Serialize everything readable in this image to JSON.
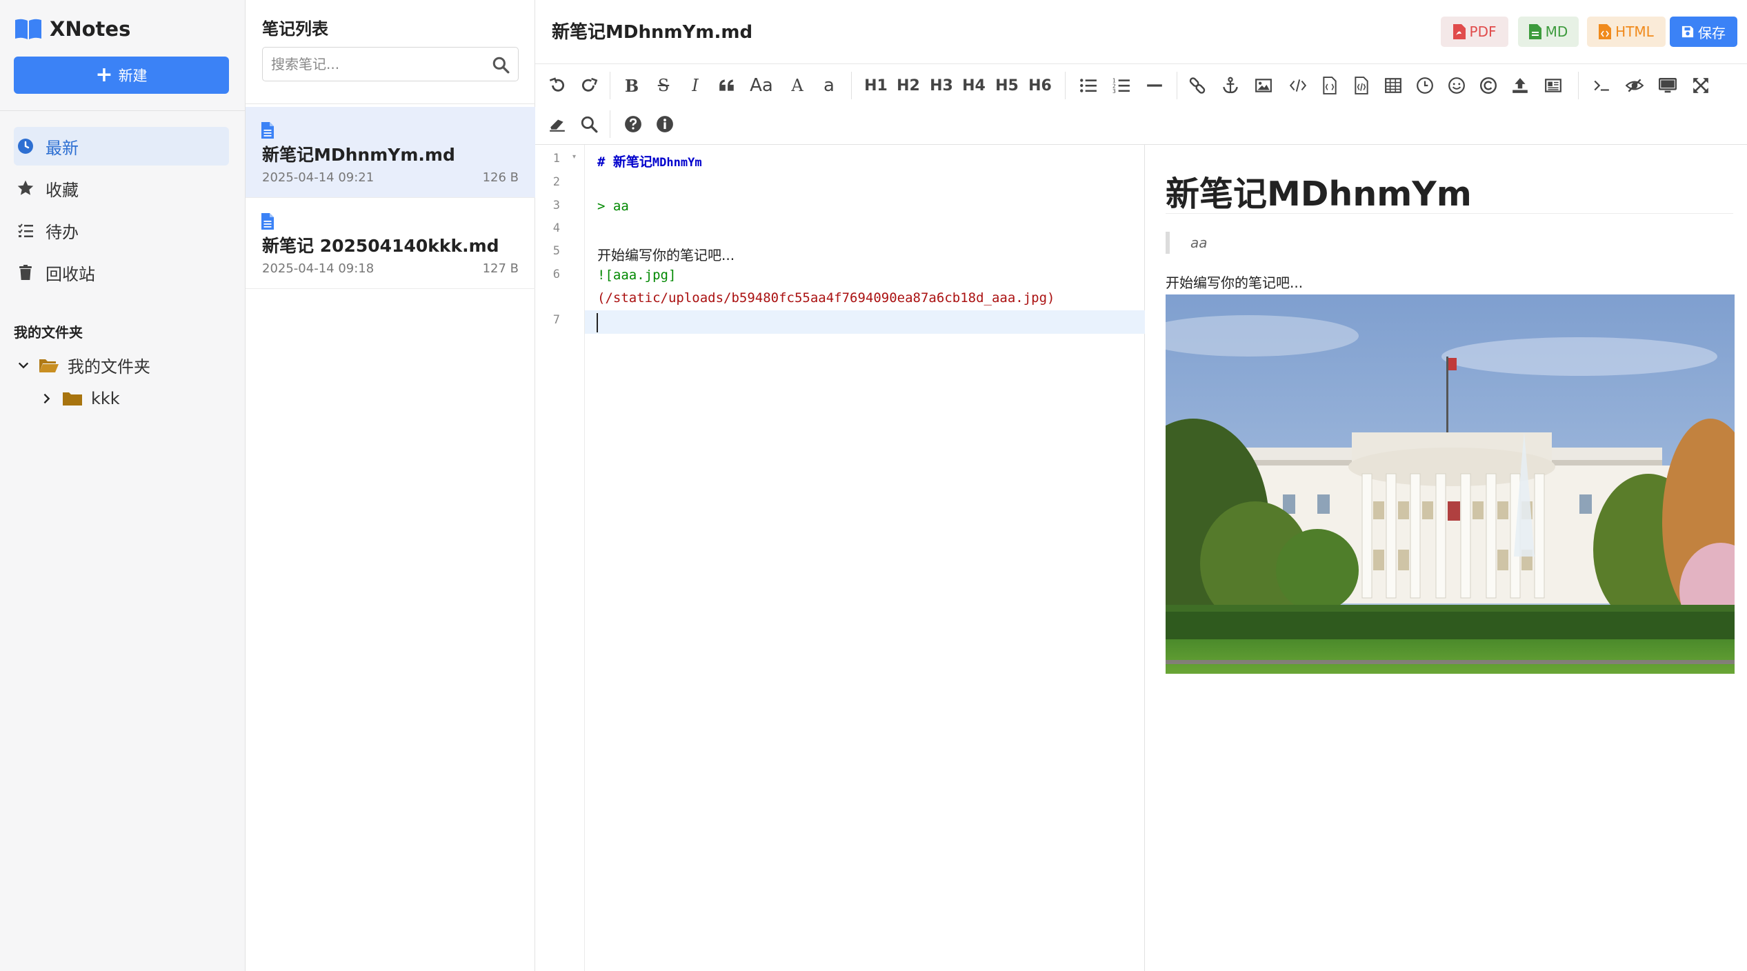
{
  "app": {
    "name": "XNotes"
  },
  "sidebar": {
    "new_button": "新建",
    "nav": [
      {
        "label": "最新",
        "icon": "clock-icon",
        "active": true
      },
      {
        "label": "收藏",
        "icon": "star-icon"
      },
      {
        "label": "待办",
        "icon": "todo-list-icon"
      },
      {
        "label": "回收站",
        "icon": "trash-icon"
      }
    ],
    "folders_title": "我的文件夹",
    "folders": [
      {
        "label": "我的文件夹",
        "expanded": true,
        "children": [
          {
            "label": "kkk",
            "expanded": false
          }
        ]
      }
    ]
  },
  "notelist": {
    "title": "笔记列表",
    "search_placeholder": "搜索笔记...",
    "notes": [
      {
        "title": "新笔记MDhnmYm.md",
        "date": "2025-04-14 09:21",
        "size": "126 B",
        "active": true
      },
      {
        "title": "新笔记 202504140kkk.md",
        "date": "2025-04-14 09:18",
        "size": "127 B"
      }
    ]
  },
  "editor": {
    "title": "新笔记MDhnmYm.md",
    "buttons": {
      "pdf": "PDF",
      "md": "MD",
      "html": "HTML",
      "save": "保存"
    },
    "toolbar": {
      "headings": [
        "H1",
        "H2",
        "H3",
        "H4",
        "H5",
        "H6"
      ],
      "font_size_label": "Aa"
    },
    "code": {
      "line_numbers": [
        "1",
        "2",
        "3",
        "4",
        "5",
        "6",
        "7"
      ],
      "line1_hash": "# ",
      "line1_title": "新笔记",
      "line1_title_rest": "MDhnmYm",
      "line3": "> aa",
      "line5": "开始编写你的笔记吧...",
      "line6_alt": "![aaa.jpg]",
      "line6_url": "(/static/uploads/b59480fc55aa4f7694090ea87a6cb18d_aaa.jpg)"
    },
    "preview": {
      "h1": "新笔记MDhnmYm",
      "quote": "aa",
      "text": "开始编写你的笔记吧..."
    }
  },
  "colors": {
    "accent": "#3b82f6",
    "pdf": "#e04b4b",
    "md": "#3d9b3d",
    "html": "#f08a1c"
  }
}
